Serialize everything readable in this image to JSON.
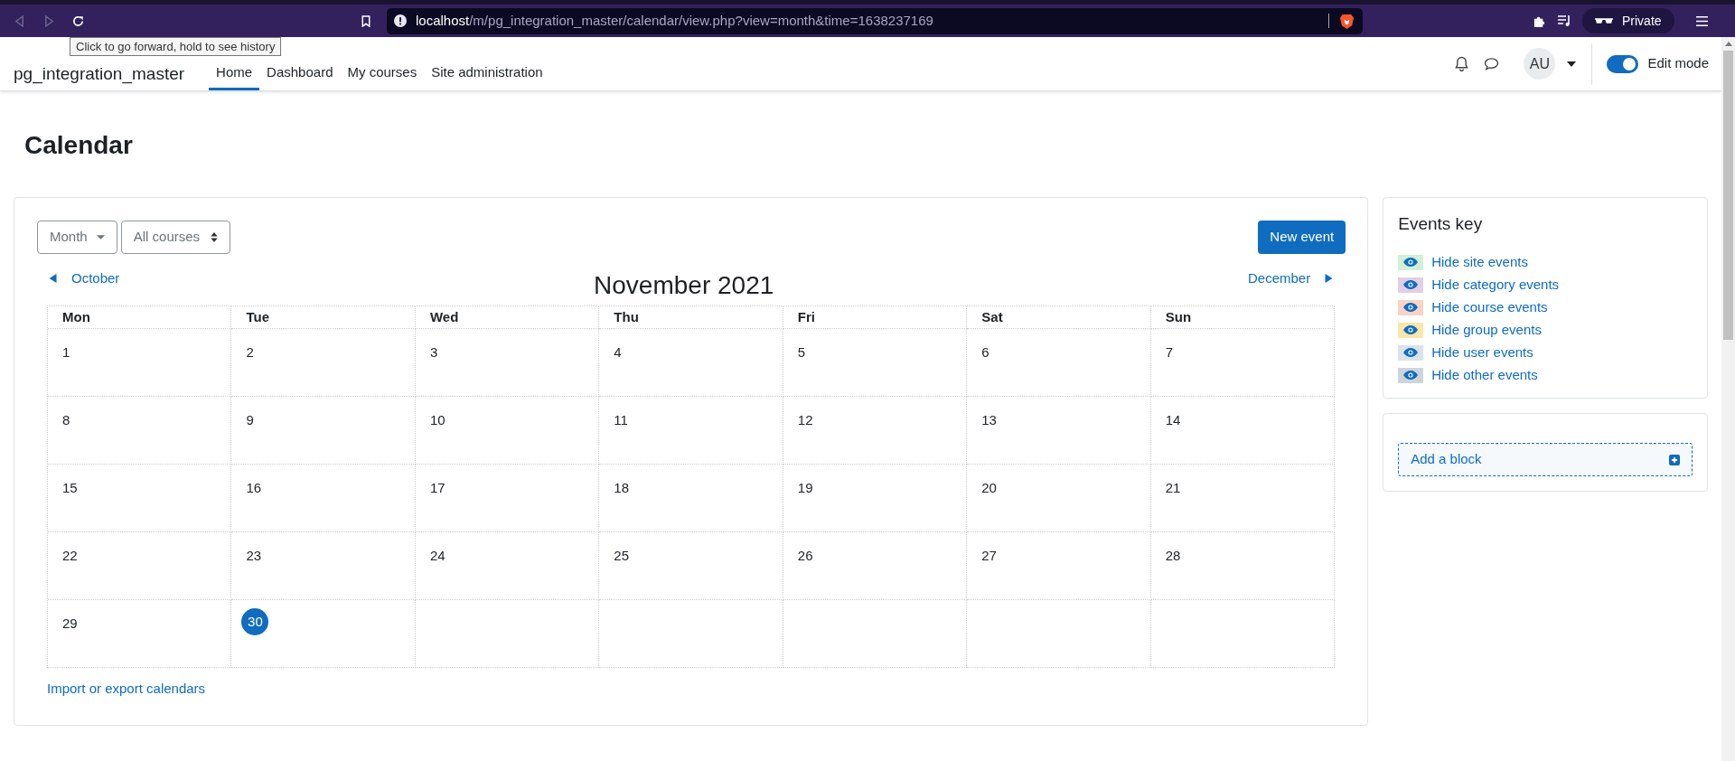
{
  "browser": {
    "url_host": "localhost",
    "url_path": "/m/pg_integration_master/calendar/view.php?view=month&time=1638237169",
    "private_label": "Private",
    "tooltip": "Click to go forward, hold to see history"
  },
  "header": {
    "site_name": "pg_integration_master",
    "nav": [
      {
        "label": "Home",
        "selected": true
      },
      {
        "label": "Dashboard",
        "selected": false
      },
      {
        "label": "My courses",
        "selected": false
      },
      {
        "label": "Site administration",
        "selected": false
      }
    ],
    "avatar": "AU",
    "edit_mode": {
      "label": "Edit mode",
      "on": true
    }
  },
  "page_title": "Calendar",
  "calendar": {
    "view_select": "Month",
    "course_select": "All courses",
    "new_event": "New event",
    "prev_month": "October",
    "next_month": "December",
    "month_title": "November 2021",
    "columns": [
      "Mon",
      "Tue",
      "Wed",
      "Thu",
      "Fri",
      "Sat",
      "Sun"
    ],
    "weeks": [
      [
        {
          "day": "1",
          "today": false
        },
        {
          "day": "2",
          "today": false
        },
        {
          "day": "3",
          "today": false
        },
        {
          "day": "4",
          "today": false
        },
        {
          "day": "5",
          "today": false
        },
        {
          "day": "6",
          "today": false
        },
        {
          "day": "7",
          "today": false
        }
      ],
      [
        {
          "day": "8",
          "today": false
        },
        {
          "day": "9",
          "today": false
        },
        {
          "day": "10",
          "today": false
        },
        {
          "day": "11",
          "today": false
        },
        {
          "day": "12",
          "today": false
        },
        {
          "day": "13",
          "today": false
        },
        {
          "day": "14",
          "today": false
        }
      ],
      [
        {
          "day": "15",
          "today": false
        },
        {
          "day": "16",
          "today": false
        },
        {
          "day": "17",
          "today": false
        },
        {
          "day": "18",
          "today": false
        },
        {
          "day": "19",
          "today": false
        },
        {
          "day": "20",
          "today": false
        },
        {
          "day": "21",
          "today": false
        }
      ],
      [
        {
          "day": "22",
          "today": false
        },
        {
          "day": "23",
          "today": false
        },
        {
          "day": "24",
          "today": false
        },
        {
          "day": "25",
          "today": false
        },
        {
          "day": "26",
          "today": false
        },
        {
          "day": "27",
          "today": false
        },
        {
          "day": "28",
          "today": false
        }
      ],
      [
        {
          "day": "29",
          "today": false
        },
        {
          "day": "30",
          "today": true
        }
      ]
    ],
    "import_link": "Import or export calendars"
  },
  "events_key": {
    "title": "Events key",
    "items": [
      {
        "label": "Hide site events",
        "color": "#d1f0d6"
      },
      {
        "label": "Hide category events",
        "color": "#e2cfe4"
      },
      {
        "label": "Hide course events",
        "color": "#fbd3c4"
      },
      {
        "label": "Hide group events",
        "color": "#fde6a8"
      },
      {
        "label": "Hide user events",
        "color": "#dbe3ea"
      },
      {
        "label": "Hide other events",
        "color": "#ced4da"
      }
    ]
  },
  "add_block": "Add a block"
}
